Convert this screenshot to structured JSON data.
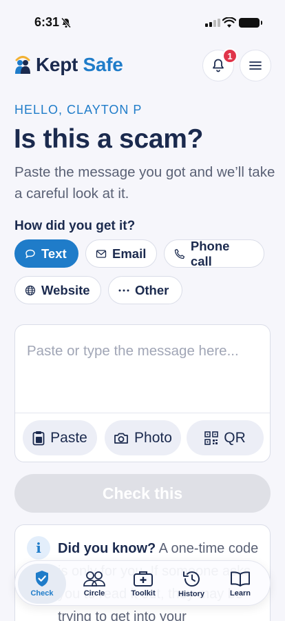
{
  "status_bar": {
    "time": "6:31"
  },
  "header": {
    "brand_first": "Kept",
    "brand_second": "Safe",
    "notification_count": "1"
  },
  "greeting": "HELLO, CLAYTON P",
  "title": "Is this a scam?",
  "subtitle": "Paste the message you got and we’ll take a careful look at it.",
  "channel": {
    "question": "How did you get it?",
    "options": [
      {
        "label": "Text",
        "icon": "chat-bubble-icon",
        "selected": true
      },
      {
        "label": "Email",
        "icon": "envelope-icon",
        "selected": false
      },
      {
        "label": "Phone call",
        "icon": "phone-icon",
        "selected": false
      },
      {
        "label": "Website",
        "icon": "globe-icon",
        "selected": false
      },
      {
        "label": "Other",
        "icon": "ellipsis-icon",
        "selected": false
      }
    ]
  },
  "message": {
    "placeholder": "Paste or type the message here...",
    "tools": [
      {
        "label": "Paste",
        "icon": "clipboard-icon"
      },
      {
        "label": "Photo",
        "icon": "camera-icon"
      },
      {
        "label": "QR",
        "icon": "qr-code-icon"
      }
    ]
  },
  "check_button": "Check this",
  "tip": {
    "heading": "Did you know?",
    "body": "A one-time code is only for you. If someone asks you to read it out, they may be trying to get into your"
  },
  "nav": {
    "items": [
      {
        "label": "Check",
        "icon": "shield-check-icon",
        "active": true
      },
      {
        "label": "Circle",
        "icon": "people-icon",
        "active": false
      },
      {
        "label": "Toolkit",
        "icon": "first-aid-kit-icon",
        "active": false
      },
      {
        "label": "History",
        "icon": "history-icon",
        "active": false
      },
      {
        "label": "Learn",
        "icon": "book-icon",
        "active": false
      }
    ]
  },
  "colors": {
    "accent": "#1f7cc9",
    "navy": "#1b2a4e",
    "badge": "#e0344a",
    "disabled_button": "#dfe0e6"
  }
}
